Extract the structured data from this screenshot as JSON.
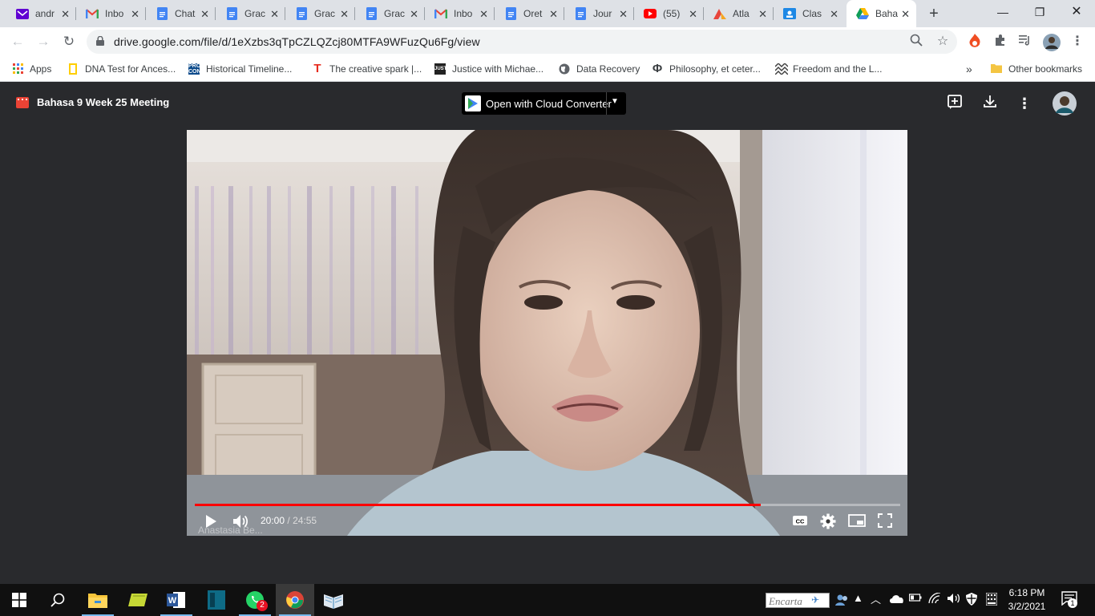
{
  "tabs": [
    {
      "title": "andr",
      "icon": "yahoo-mail-icon",
      "active": false
    },
    {
      "title": "Inbo",
      "icon": "gmail-icon",
      "active": false
    },
    {
      "title": "Chat",
      "icon": "docs-icon",
      "active": false
    },
    {
      "title": "Grac",
      "icon": "docs-icon",
      "active": false
    },
    {
      "title": "Grac",
      "icon": "docs-icon",
      "active": false
    },
    {
      "title": "Grac",
      "icon": "docs-icon",
      "active": false
    },
    {
      "title": "Inbo",
      "icon": "gmail-icon",
      "active": false
    },
    {
      "title": "Oret",
      "icon": "docs-icon",
      "active": false
    },
    {
      "title": "Jour",
      "icon": "docs-icon",
      "active": false
    },
    {
      "title": "(55)",
      "icon": "youtube-icon",
      "active": false
    },
    {
      "title": "Atla",
      "icon": "atlas-icon",
      "active": false
    },
    {
      "title": "Clas",
      "icon": "classroom-icon",
      "active": false
    },
    {
      "title": "Baha",
      "icon": "google-drive-icon",
      "active": true
    }
  ],
  "address": {
    "url": "drive.google.com/file/d/1eXzbs3qTpCZLQZcj80MTFA9WFuzQu6Fg/view"
  },
  "bookmarks": {
    "apps": "Apps",
    "items": [
      "DNA Test for Ances...",
      "Historical Timeline...",
      "The creative spark |...",
      "Justice with Michae...",
      "Data Recovery",
      "Philosophy, et ceter...",
      "Freedom and the L..."
    ],
    "overflow": "»",
    "other": "Other bookmarks"
  },
  "viewer": {
    "title": "Bahasa 9 Week 25 Meeting",
    "open_with": "Open with Cloud Converter"
  },
  "player": {
    "current_time": "20:00",
    "separator": "/",
    "duration": "24:55",
    "progress_fraction": 0.8027,
    "caption_overlay": "Anastasia Be..."
  },
  "taskbar": {
    "whatsapp_badge": "2",
    "encarta_label": "Encarta",
    "time": "6:18 PM",
    "date": "3/2/2021",
    "notification_count": "1"
  },
  "colors": {
    "progress": "#ff0000",
    "tabstrip": "#dee1e6",
    "viewer_bg": "#292a2d"
  }
}
